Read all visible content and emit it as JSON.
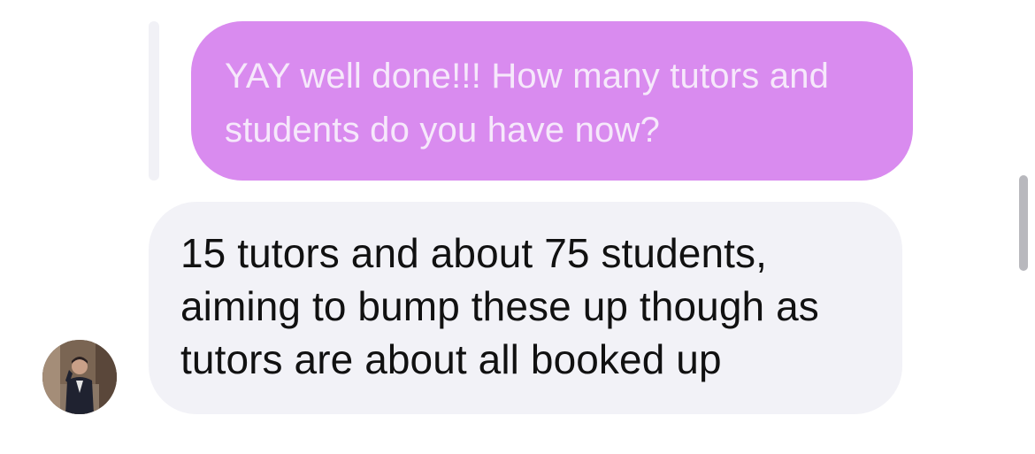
{
  "colors": {
    "quoted_bubble_bg": "#d98bef",
    "quoted_bubble_text": "#f6e8fb",
    "reply_bubble_bg": "#f2f2f7",
    "reply_text": "#111111",
    "thread_line": "#f1f1f6",
    "scrollbar": "#b8b8bd"
  },
  "conversation": {
    "quoted_message": {
      "text": "YAY well done!!! How many tutors and\nstudents do you have now?"
    },
    "reply_message": {
      "text": "15 tutors and about 75 students,\naiming to bump these up though as\ntutors are about all booked up"
    },
    "avatar_icon": "person-photo-icon"
  }
}
